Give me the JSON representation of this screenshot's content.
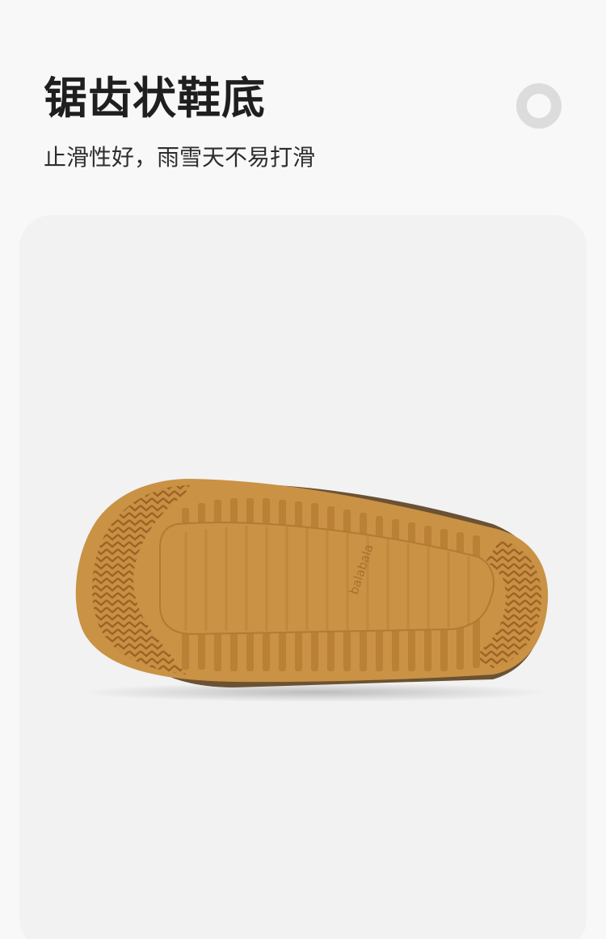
{
  "header": {
    "title": "锯齿状鞋底",
    "subtitle": "止滑性好，雨雪天不易打滑",
    "decor_icon": "ring-icon"
  },
  "product": {
    "image": "shoe-sole-image",
    "logo_text": "balabala",
    "colors": {
      "sole": "#c9924a",
      "sole_shadow": "#a56d2c",
      "upper": "#6b5233",
      "panel": "#f2f2f2",
      "background": "#f8f8f8"
    }
  }
}
